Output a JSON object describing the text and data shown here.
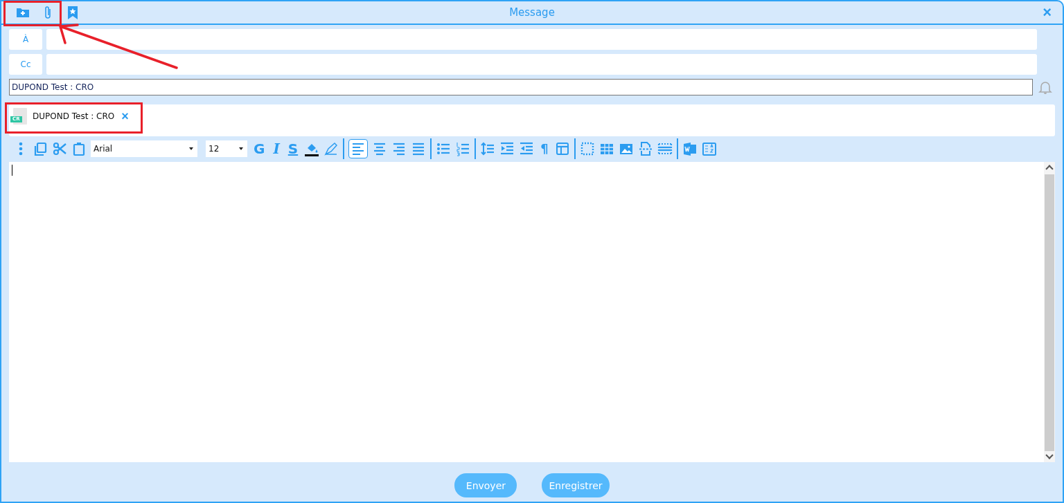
{
  "window": {
    "title": "Message",
    "close": "×"
  },
  "recipients": [
    {
      "label": "À"
    },
    {
      "label": "Cc"
    }
  ],
  "subject": {
    "value": "DUPOND Test : CRO"
  },
  "attachments": [
    {
      "name": "DUPOND Test : CRO",
      "badge": "CR",
      "remove": "×"
    }
  ],
  "toolbar": {
    "font": "Arial",
    "size": "12",
    "format_buttons": [
      {
        "label": "G",
        "kind": "bold"
      },
      {
        "label": "I",
        "kind": "italic"
      },
      {
        "label": "S",
        "kind": "underline"
      }
    ],
    "align_buttons": [
      {
        "selected": true
      },
      {
        "selected": false
      },
      {
        "selected": false
      },
      {
        "selected": false
      }
    ],
    "pilcrow": "¶"
  },
  "buttons": [
    {
      "label": "Envoyer"
    },
    {
      "label": "Enregistrer"
    }
  ]
}
